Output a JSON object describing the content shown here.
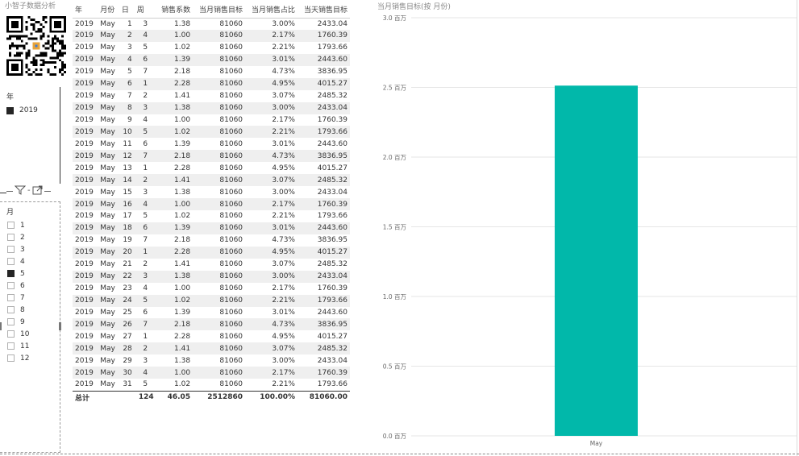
{
  "brand": "小智子数据分析",
  "year_slicer": {
    "title": "年",
    "items": [
      {
        "label": "2019",
        "checked": true
      }
    ]
  },
  "month_slicer": {
    "title": "月",
    "items": [
      {
        "label": "1",
        "checked": false
      },
      {
        "label": "2",
        "checked": false
      },
      {
        "label": "3",
        "checked": false
      },
      {
        "label": "4",
        "checked": false
      },
      {
        "label": "5",
        "checked": true
      },
      {
        "label": "6",
        "checked": false
      },
      {
        "label": "7",
        "checked": false
      },
      {
        "label": "8",
        "checked": false
      },
      {
        "label": "9",
        "checked": false
      },
      {
        "label": "10",
        "checked": false
      },
      {
        "label": "11",
        "checked": false
      },
      {
        "label": "12",
        "checked": false
      }
    ]
  },
  "table": {
    "headers": [
      "年",
      "月份",
      "日",
      "周",
      "销售系数",
      "当月销售目标",
      "当月销售占比",
      "当天销售目标"
    ],
    "rows": [
      [
        "2019",
        "May",
        "1",
        "3",
        "1.38",
        "81060",
        "3.00%",
        "2433.04"
      ],
      [
        "2019",
        "May",
        "2",
        "4",
        "1.00",
        "81060",
        "2.17%",
        "1760.39"
      ],
      [
        "2019",
        "May",
        "3",
        "5",
        "1.02",
        "81060",
        "2.21%",
        "1793.66"
      ],
      [
        "2019",
        "May",
        "4",
        "6",
        "1.39",
        "81060",
        "3.01%",
        "2443.60"
      ],
      [
        "2019",
        "May",
        "5",
        "7",
        "2.18",
        "81060",
        "4.73%",
        "3836.95"
      ],
      [
        "2019",
        "May",
        "6",
        "1",
        "2.28",
        "81060",
        "4.95%",
        "4015.27"
      ],
      [
        "2019",
        "May",
        "7",
        "2",
        "1.41",
        "81060",
        "3.07%",
        "2485.32"
      ],
      [
        "2019",
        "May",
        "8",
        "3",
        "1.38",
        "81060",
        "3.00%",
        "2433.04"
      ],
      [
        "2019",
        "May",
        "9",
        "4",
        "1.00",
        "81060",
        "2.17%",
        "1760.39"
      ],
      [
        "2019",
        "May",
        "10",
        "5",
        "1.02",
        "81060",
        "2.21%",
        "1793.66"
      ],
      [
        "2019",
        "May",
        "11",
        "6",
        "1.39",
        "81060",
        "3.01%",
        "2443.60"
      ],
      [
        "2019",
        "May",
        "12",
        "7",
        "2.18",
        "81060",
        "4.73%",
        "3836.95"
      ],
      [
        "2019",
        "May",
        "13",
        "1",
        "2.28",
        "81060",
        "4.95%",
        "4015.27"
      ],
      [
        "2019",
        "May",
        "14",
        "2",
        "1.41",
        "81060",
        "3.07%",
        "2485.32"
      ],
      [
        "2019",
        "May",
        "15",
        "3",
        "1.38",
        "81060",
        "3.00%",
        "2433.04"
      ],
      [
        "2019",
        "May",
        "16",
        "4",
        "1.00",
        "81060",
        "2.17%",
        "1760.39"
      ],
      [
        "2019",
        "May",
        "17",
        "5",
        "1.02",
        "81060",
        "2.21%",
        "1793.66"
      ],
      [
        "2019",
        "May",
        "18",
        "6",
        "1.39",
        "81060",
        "3.01%",
        "2443.60"
      ],
      [
        "2019",
        "May",
        "19",
        "7",
        "2.18",
        "81060",
        "4.73%",
        "3836.95"
      ],
      [
        "2019",
        "May",
        "20",
        "1",
        "2.28",
        "81060",
        "4.95%",
        "4015.27"
      ],
      [
        "2019",
        "May",
        "21",
        "2",
        "1.41",
        "81060",
        "3.07%",
        "2485.32"
      ],
      [
        "2019",
        "May",
        "22",
        "3",
        "1.38",
        "81060",
        "3.00%",
        "2433.04"
      ],
      [
        "2019",
        "May",
        "23",
        "4",
        "1.00",
        "81060",
        "2.17%",
        "1760.39"
      ],
      [
        "2019",
        "May",
        "24",
        "5",
        "1.02",
        "81060",
        "2.21%",
        "1793.66"
      ],
      [
        "2019",
        "May",
        "25",
        "6",
        "1.39",
        "81060",
        "3.01%",
        "2443.60"
      ],
      [
        "2019",
        "May",
        "26",
        "7",
        "2.18",
        "81060",
        "4.73%",
        "3836.95"
      ],
      [
        "2019",
        "May",
        "27",
        "1",
        "2.28",
        "81060",
        "4.95%",
        "4015.27"
      ],
      [
        "2019",
        "May",
        "28",
        "2",
        "1.41",
        "81060",
        "3.07%",
        "2485.32"
      ],
      [
        "2019",
        "May",
        "29",
        "3",
        "1.38",
        "81060",
        "3.00%",
        "2433.04"
      ],
      [
        "2019",
        "May",
        "30",
        "4",
        "1.00",
        "81060",
        "2.17%",
        "1760.39"
      ],
      [
        "2019",
        "May",
        "31",
        "5",
        "1.02",
        "81060",
        "2.21%",
        "1793.66"
      ]
    ],
    "total": [
      "总计",
      "",
      "",
      "124",
      "46.05",
      "2512860",
      "100.00%",
      "81060.00"
    ]
  },
  "chart_data": {
    "type": "bar",
    "title": "当月销售目标(按 月份)",
    "categories": [
      "May"
    ],
    "values": [
      2512860
    ],
    "ylim": [
      0,
      3000000
    ],
    "yticks": [
      0,
      500000,
      1000000,
      1500000,
      2000000,
      2500000,
      3000000
    ],
    "ytick_labels": [
      "0.0 百万",
      "0.5 百万",
      "1.0 百万",
      "1.5 百万",
      "2.0 百万",
      "2.5 百万",
      "3.0 百万"
    ],
    "grid": true,
    "bar_color": "#01B8AA"
  }
}
